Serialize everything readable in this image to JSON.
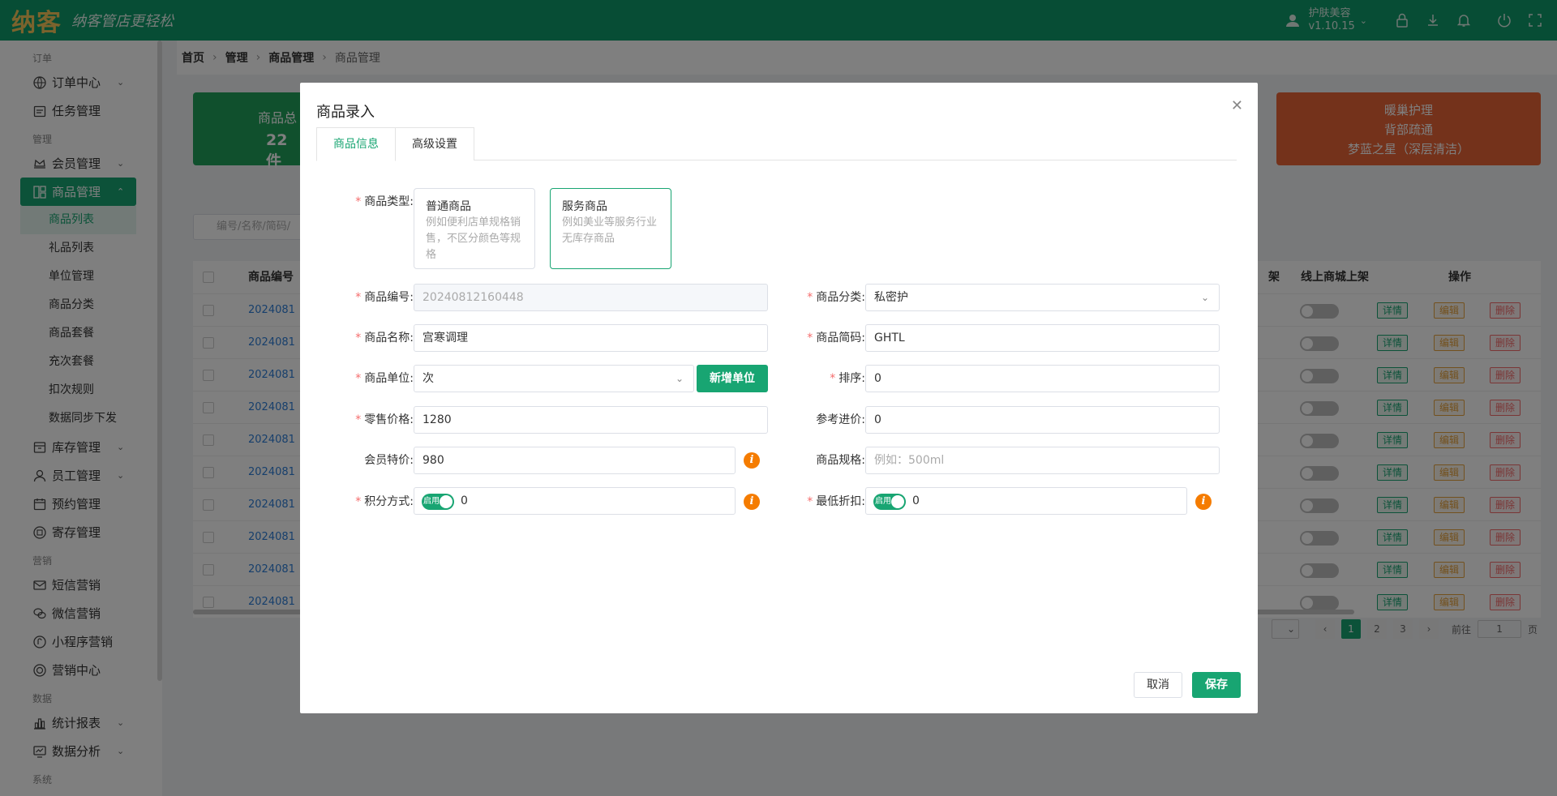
{
  "header": {
    "logo": "纳客",
    "slogan": "纳客管店更轻松",
    "user_name": "护肤美容",
    "version": "v1.10.15",
    "icons": [
      "user-icon",
      "lock-icon",
      "download-icon",
      "bell-icon",
      "power-icon",
      "fullscreen-icon"
    ]
  },
  "sidebar": {
    "sections": {
      "order": "订单",
      "manage": "管理",
      "marketing": "营销",
      "data": "数据",
      "system": "系统"
    },
    "items": {
      "order_center": "订单中心",
      "task_manage": "任务管理",
      "member_manage": "会员管理",
      "goods_manage": "商品管理",
      "goods_list": "商品列表",
      "gift_list": "礼品列表",
      "unit_manage": "单位管理",
      "goods_category": "商品分类",
      "goods_package": "商品套餐",
      "recharge_package": "充次套餐",
      "deduct_rule": "扣次规则",
      "data_sync": "数据同步下发",
      "stock_manage": "库存管理",
      "staff_manage": "员工管理",
      "booking_manage": "预约管理",
      "deposit_manage": "寄存管理",
      "sms_marketing": "短信营销",
      "wechat_marketing": "微信营销",
      "miniapp_marketing": "小程序营销",
      "marketing_center": "营销中心",
      "stats_report": "统计报表",
      "data_analysis": "数据分析"
    }
  },
  "breadcrumb": [
    "首页",
    "管理",
    "商品管理",
    "商品管理"
  ],
  "background": {
    "stat_card_label": "商品总",
    "stat_card_value": "22 件",
    "hot_items": [
      "暖巢护理",
      "背部疏通",
      "梦蓝之星（深层清洁）"
    ],
    "search_placeholder": "编号/名称/简码/",
    "table_headers": {
      "code": "商品编号",
      "shelf": "架",
      "online_shelf": "线上商城上架",
      "actions": "操作"
    },
    "row_codes": [
      "2024081",
      "2024081",
      "2024081",
      "2024081",
      "2024081",
      "2024081",
      "2024081",
      "2024081",
      "2024081",
      "2024081"
    ],
    "actions": {
      "detail": "详情",
      "edit": "编辑",
      "delete": "删除"
    },
    "pager": {
      "pages": [
        "1",
        "2",
        "3"
      ],
      "goto_label": "前往",
      "goto_value": "1",
      "page_unit": "页"
    }
  },
  "dialog": {
    "title": "商品录入",
    "tabs": [
      "商品信息",
      "高级设置"
    ],
    "type_label": "商品类型:",
    "type_options": [
      {
        "title": "普通商品",
        "desc": "例如便利店单规格销售，不区分颜色等规格"
      },
      {
        "title": "服务商品",
        "desc": "例如美业等服务行业无库存商品"
      }
    ],
    "fields": {
      "code_label": "商品编号:",
      "code_value": "20240812160448",
      "category_label": "商品分类:",
      "category_value": "私密护",
      "name_label": "商品名称:",
      "name_value": "宫寒调理",
      "short_label": "商品简码:",
      "short_value": "GHTL",
      "unit_label": "商品单位:",
      "unit_value": "次",
      "add_unit_button": "新增单位",
      "sort_label": "排序:",
      "sort_value": "0",
      "retail_label": "零售价格:",
      "retail_value": "1280",
      "ref_price_label": "参考进价:",
      "ref_price_value": "0",
      "member_price_label": "会员特价:",
      "member_price_value": "980",
      "spec_label": "商品规格:",
      "spec_placeholder": "例如：500ml",
      "points_label": "积分方式:",
      "points_toggle": "启用",
      "points_value": "0",
      "min_discount_label": "最低折扣:",
      "min_discount_toggle": "启用",
      "min_discount_value": "0"
    },
    "cancel_button": "取消",
    "save_button": "保存"
  },
  "colors": {
    "brand": "#0e9a6b",
    "accent": "#18a572",
    "warning": "#f57c00",
    "required": "#f56c6c"
  }
}
